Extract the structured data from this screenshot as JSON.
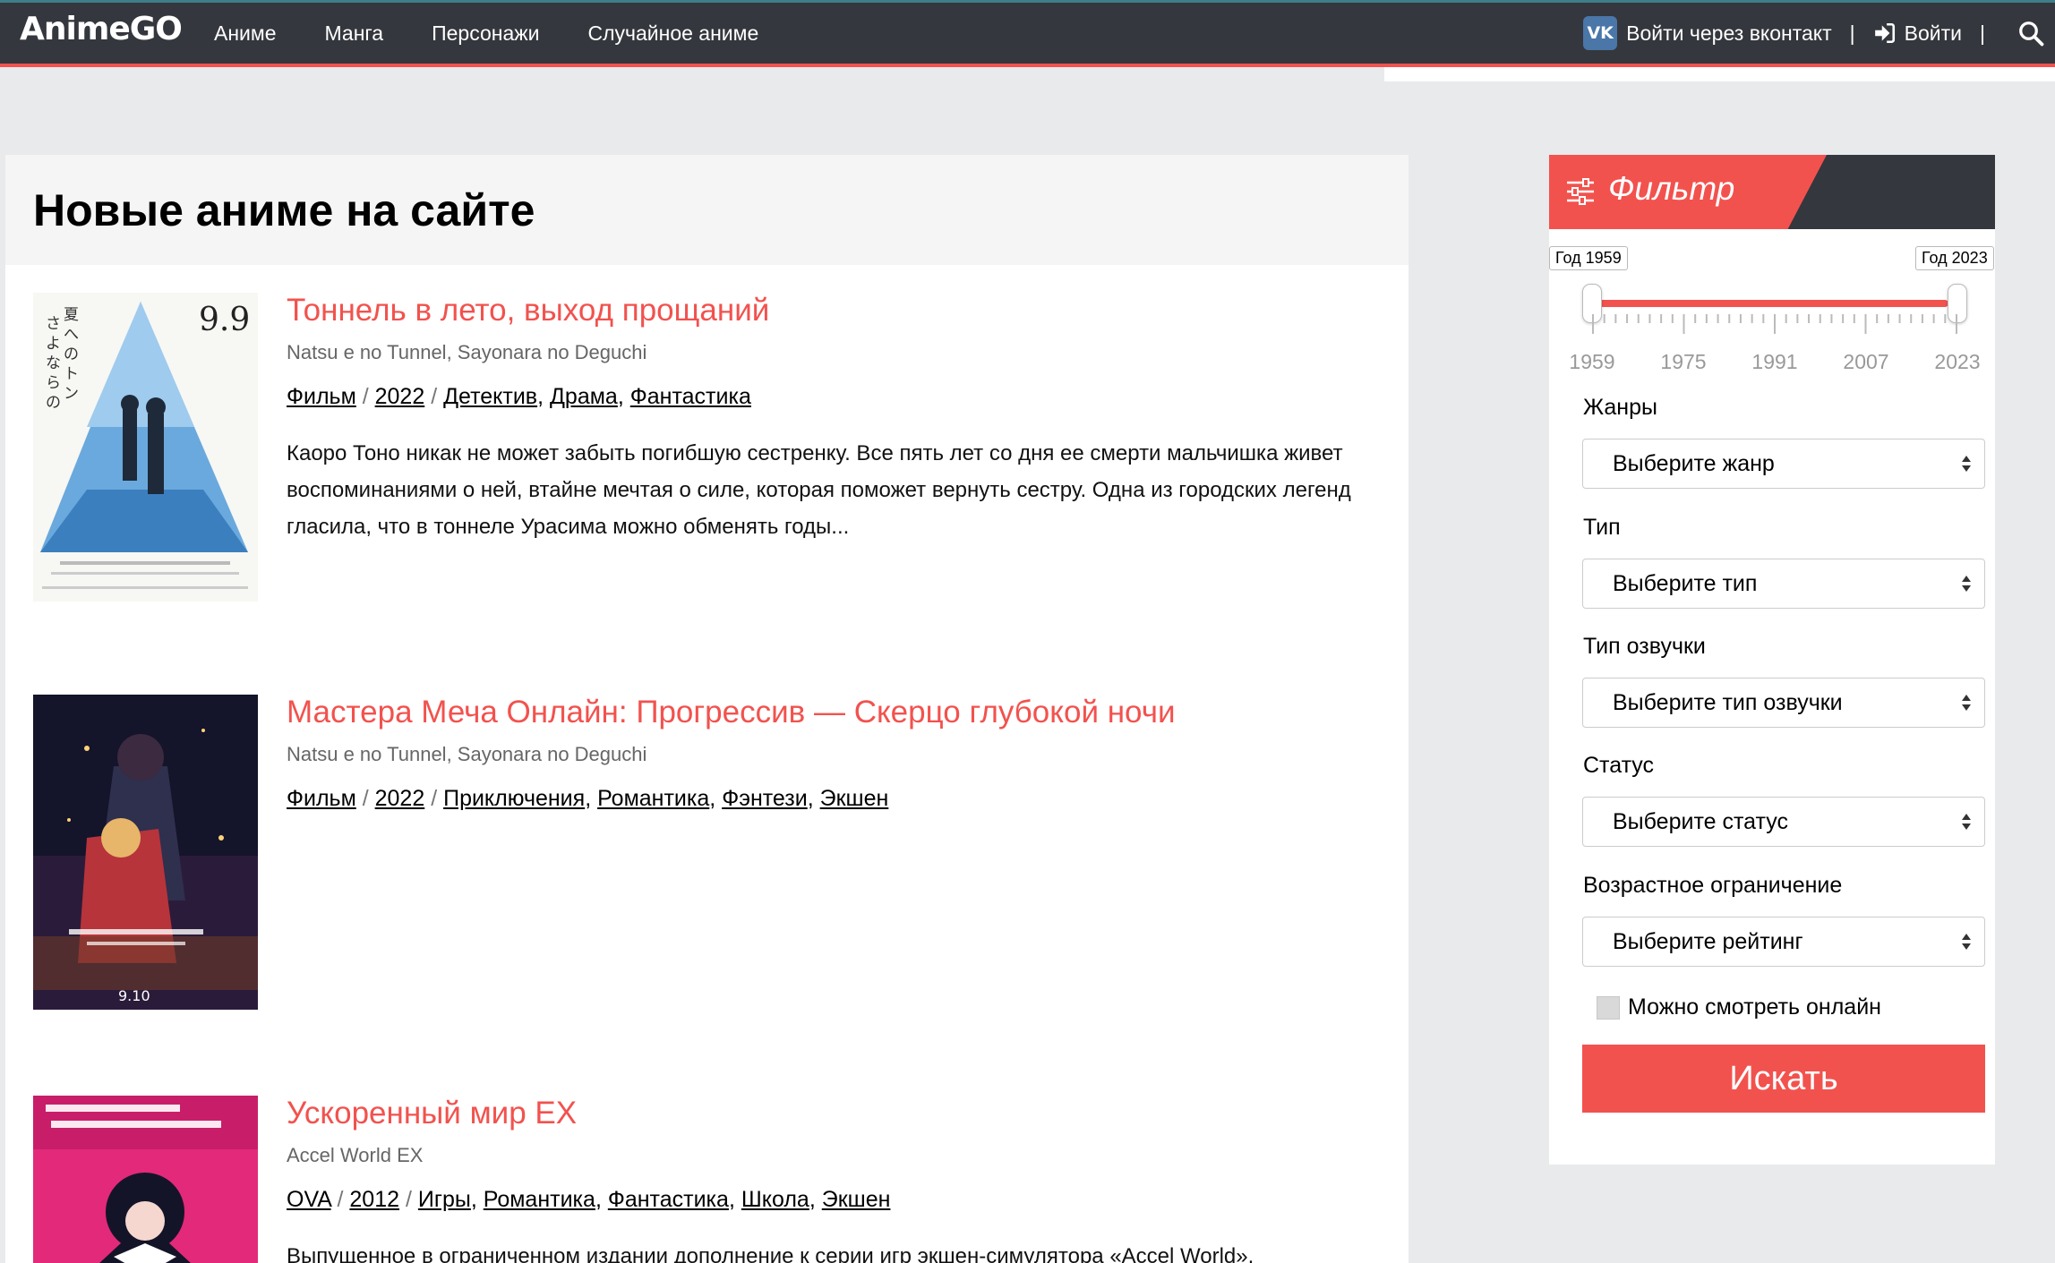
{
  "header": {
    "logo": "AnimeGO",
    "nav": [
      "Аниме",
      "Манга",
      "Персонажи",
      "Случайное аниме"
    ],
    "vk_login": "Войти через вконтакт",
    "separator": "|",
    "login": "Войти",
    "vk_icon_text": "VK"
  },
  "main": {
    "title": "Новые аниме на сайте",
    "items": [
      {
        "title": "Тоннель в лето, выход прощаний",
        "original": "Natsu e no Tunnel, Sayonara no Deguchi",
        "type": "Фильм",
        "year": "2022",
        "genres": [
          "Детектив",
          "Драма",
          "Фантастика"
        ],
        "description": "Каоро Тоно никак не может забыть погибшую сестренку. Все пять лет со дня ее смерти мальчишка живет воспоминаниями о ней, втайне мечтая о силе, которая поможет вернуть сестру. Одна из городских легенд гласила, что в тоннеле Урасима можно обменять годы...",
        "poster_text": "9.9"
      },
      {
        "title": "Мастера Меча Онлайн: Прогрессив — Скерцо глубокой ночи",
        "original": "Natsu e no Tunnel, Sayonara no Deguchi",
        "type": "Фильм",
        "year": "2022",
        "genres": [
          "Приключения",
          "Романтика",
          "Фэнтези",
          "Экшен"
        ],
        "description": "",
        "poster_text": "9.10"
      },
      {
        "title": "Ускоренный мир EX",
        "original": "Accel World EX",
        "type": "OVA",
        "year": "2012",
        "genres": [
          "Игры",
          "Романтика",
          "Фантастика",
          "Школа",
          "Экшен"
        ],
        "description": "Выпущенное в ограниченном издании дополнение к серии игр экшен-симулятора «Accel World».",
        "poster_text": ""
      }
    ]
  },
  "filter": {
    "title": "Фильтр",
    "year_from_label": "Год 1959",
    "year_to_label": "Год 2023",
    "year_from": 1959,
    "year_to": 2023,
    "scale": [
      "1959",
      "1975",
      "1991",
      "2007",
      "2023"
    ],
    "genres_label": "Жанры",
    "genres_placeholder": "Выберите жанр",
    "type_label": "Тип",
    "type_placeholder": "Выберите тип",
    "voice_label": "Тип озвучки",
    "voice_placeholder": "Выберите тип озвучки",
    "status_label": "Статус",
    "status_placeholder": "Выберите статус",
    "age_label": "Возрастное ограничение",
    "age_placeholder": "Выберите рейтинг",
    "online_label": "Можно смотреть онлайн",
    "online_checked": false,
    "search_button": "Искать"
  },
  "colors": {
    "accent": "#f2524e",
    "header_bg": "#34373d",
    "page_bg": "#e9eaec",
    "vk": "#4a76a8"
  }
}
